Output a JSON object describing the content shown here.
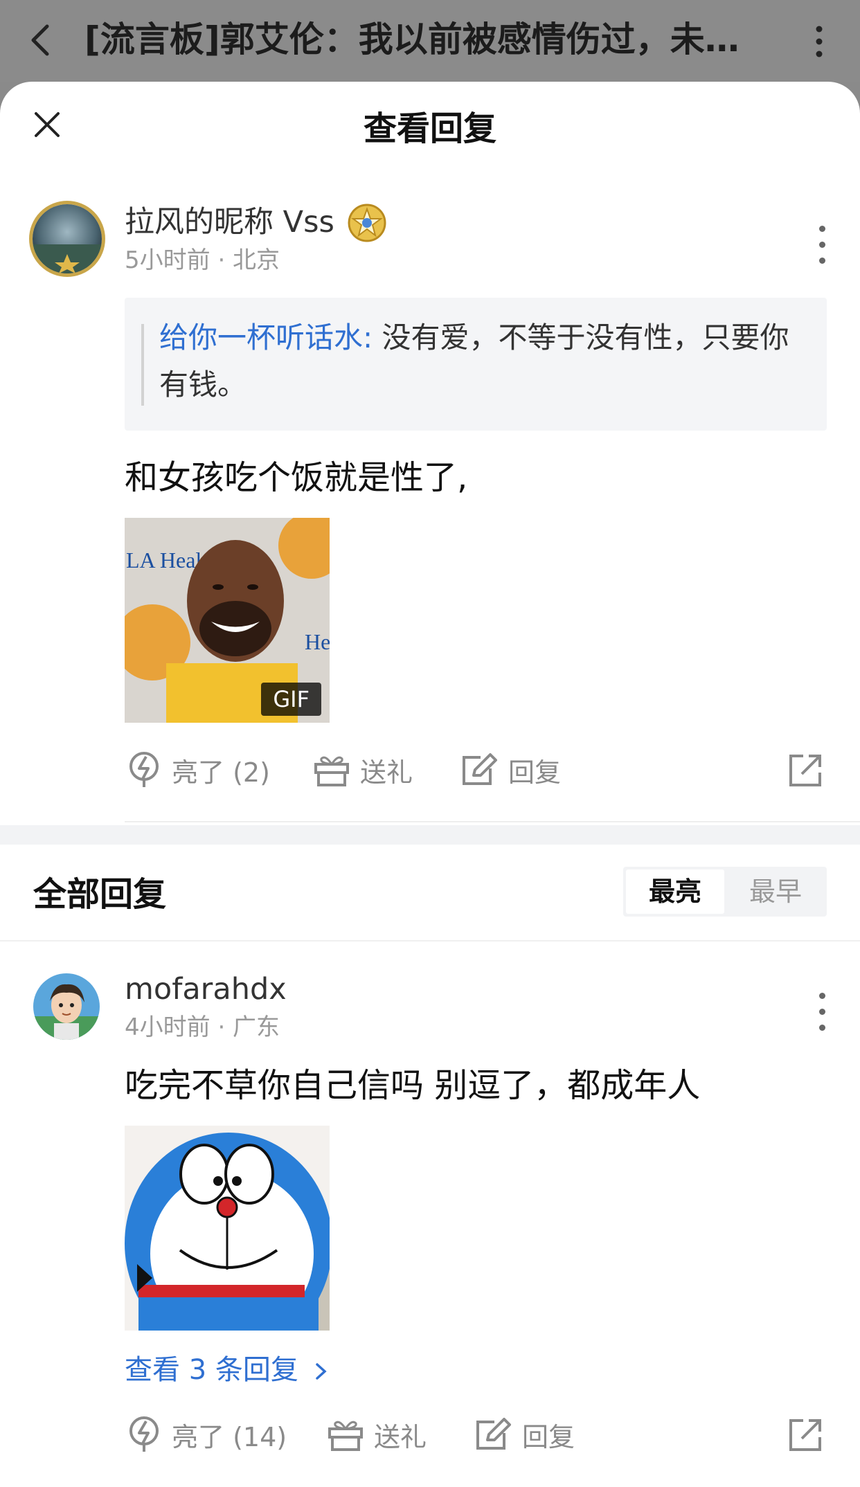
{
  "topbar": {
    "title": "[流言板]郭艾伦：我以前被感情伤过，未…"
  },
  "sheet": {
    "title": "查看回复"
  },
  "main_comment": {
    "username": "拉风的昵称 Vss",
    "time": "5小时前",
    "location": "北京",
    "meta": "5小时前 · 北京",
    "quote_name": "给你一杯听话水:",
    "quote_text": " 没有爱，不等于没有性，只要你有钱。",
    "text": "和女孩吃个饭就是性了,",
    "image_badge": "GIF",
    "actions": {
      "like": "亮了 (2)",
      "gift": "送礼",
      "reply": "回复"
    }
  },
  "all_replies": {
    "title": "全部回复",
    "sort_options": [
      "最亮",
      "最早"
    ],
    "sort_selected": "最亮"
  },
  "reply": {
    "username": "mofarahdx",
    "meta": "4小时前 · 广东",
    "text": "吃完不草你自己信吗 别逗了，都成年人",
    "more_replies": "查看 3 条回复",
    "actions": {
      "like": "亮了 (14)",
      "gift": "送礼",
      "reply": "回复"
    }
  },
  "icons": [
    "back-icon",
    "more-vertical-icon",
    "close-icon",
    "lightning-icon",
    "gift-icon",
    "edit-icon",
    "share-icon",
    "chevron-right-icon",
    "badge-icon"
  ],
  "colors": {
    "accent_blue": "#2f6fd1",
    "overlay_gray": "#8b8b8b",
    "muted_text": "#999999"
  }
}
